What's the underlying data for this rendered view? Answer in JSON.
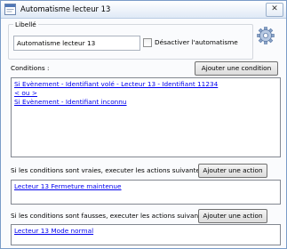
{
  "window": {
    "title": "Automatisme lecteur 13",
    "close_glyph": "✕",
    "app_icon": "app-window-icon"
  },
  "general": {
    "libelle_legend": "Libellé",
    "libelle_value": "Automatisme lecteur 13",
    "disable_label": "Désactiver l'automatisme",
    "disable_checked": false,
    "settings_icon": "gear-icon"
  },
  "conditions": {
    "label": "Conditions :",
    "add_button": "Ajouter une condition",
    "items": [
      "Si Evènement - Identifiant volé - Lecteur 13 - Identifiant 11234",
      "< ou >",
      "Si Evènement - Identifiant inconnu"
    ]
  },
  "actions_true": {
    "label": "Si les conditions sont vraies, executer les actions suivantes :",
    "add_button": "Ajouter une action",
    "items": [
      "Lecteur 13 Fermeture maintenue"
    ]
  },
  "actions_false": {
    "label": "Si les conditions sont fausses, executer les actions suivantes :",
    "add_button": "Ajouter une action",
    "items": [
      "Lecteur 13 Mode normal"
    ]
  },
  "colors": {
    "link": "#0000ee",
    "border": "#828790",
    "title_gradient_bottom": "#dfe9f6"
  }
}
